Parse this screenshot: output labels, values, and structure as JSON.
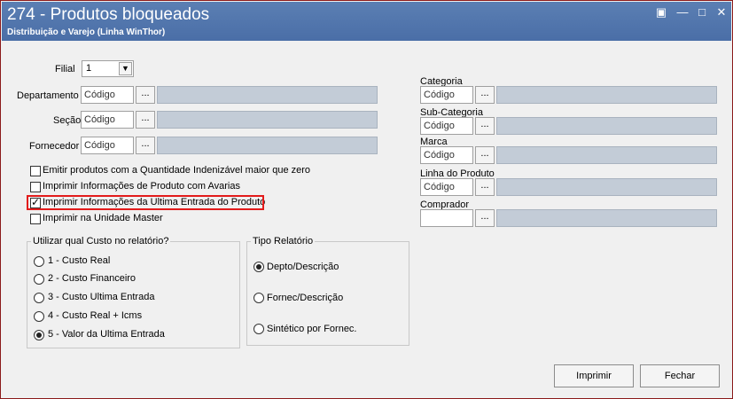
{
  "window": {
    "title": "274 - Produtos bloqueados",
    "subtitle": "Distribuição e Varejo (Linha WinThor)"
  },
  "filters": {
    "filial_label": "Filial",
    "filial_value": "1",
    "departamento_label": "Departamento",
    "secao_label": "Seção",
    "fornecedor_label": "Fornecedor",
    "codigo_placeholder": "Código",
    "browse_label": "..."
  },
  "right_filters": {
    "categoria_label": "Categoria",
    "subcategoria_label": "Sub-Categoria",
    "marca_label": "Marca",
    "linha_label": "Linha do Produto",
    "comprador_label": "Comprador",
    "codigo_placeholder": "Código",
    "comprador_value": ""
  },
  "options": [
    {
      "label": "Emitir produtos com a Quantidade Indenizável maior que zero",
      "checked": false
    },
    {
      "label": "Imprimir Informações de Produto com Avarias",
      "checked": false
    },
    {
      "label": "Imprimir Informações da Ultima Entrada do Produto",
      "checked": true
    },
    {
      "label": "Imprimir na Unidade  Master",
      "checked": false
    }
  ],
  "custo_group": {
    "title": "Utilizar qual Custo no relatório?",
    "items": [
      {
        "label": "1 - Custo Real",
        "selected": false
      },
      {
        "label": "2 - Custo Financeiro",
        "selected": false
      },
      {
        "label": "3 - Custo Ultima Entrada",
        "selected": false
      },
      {
        "label": "4 - Custo Real + Icms",
        "selected": false
      },
      {
        "label": "5 - Valor da Ultima Entrada",
        "selected": true
      }
    ]
  },
  "tipo_group": {
    "title": "Tipo Relatório",
    "items": [
      {
        "label": "Depto/Descrição",
        "selected": true
      },
      {
        "label": "Fornec/Descrição",
        "selected": false
      },
      {
        "label": "Sintético por Fornec.",
        "selected": false
      }
    ]
  },
  "actions": {
    "imprimir": "Imprimir",
    "fechar": "Fechar"
  }
}
